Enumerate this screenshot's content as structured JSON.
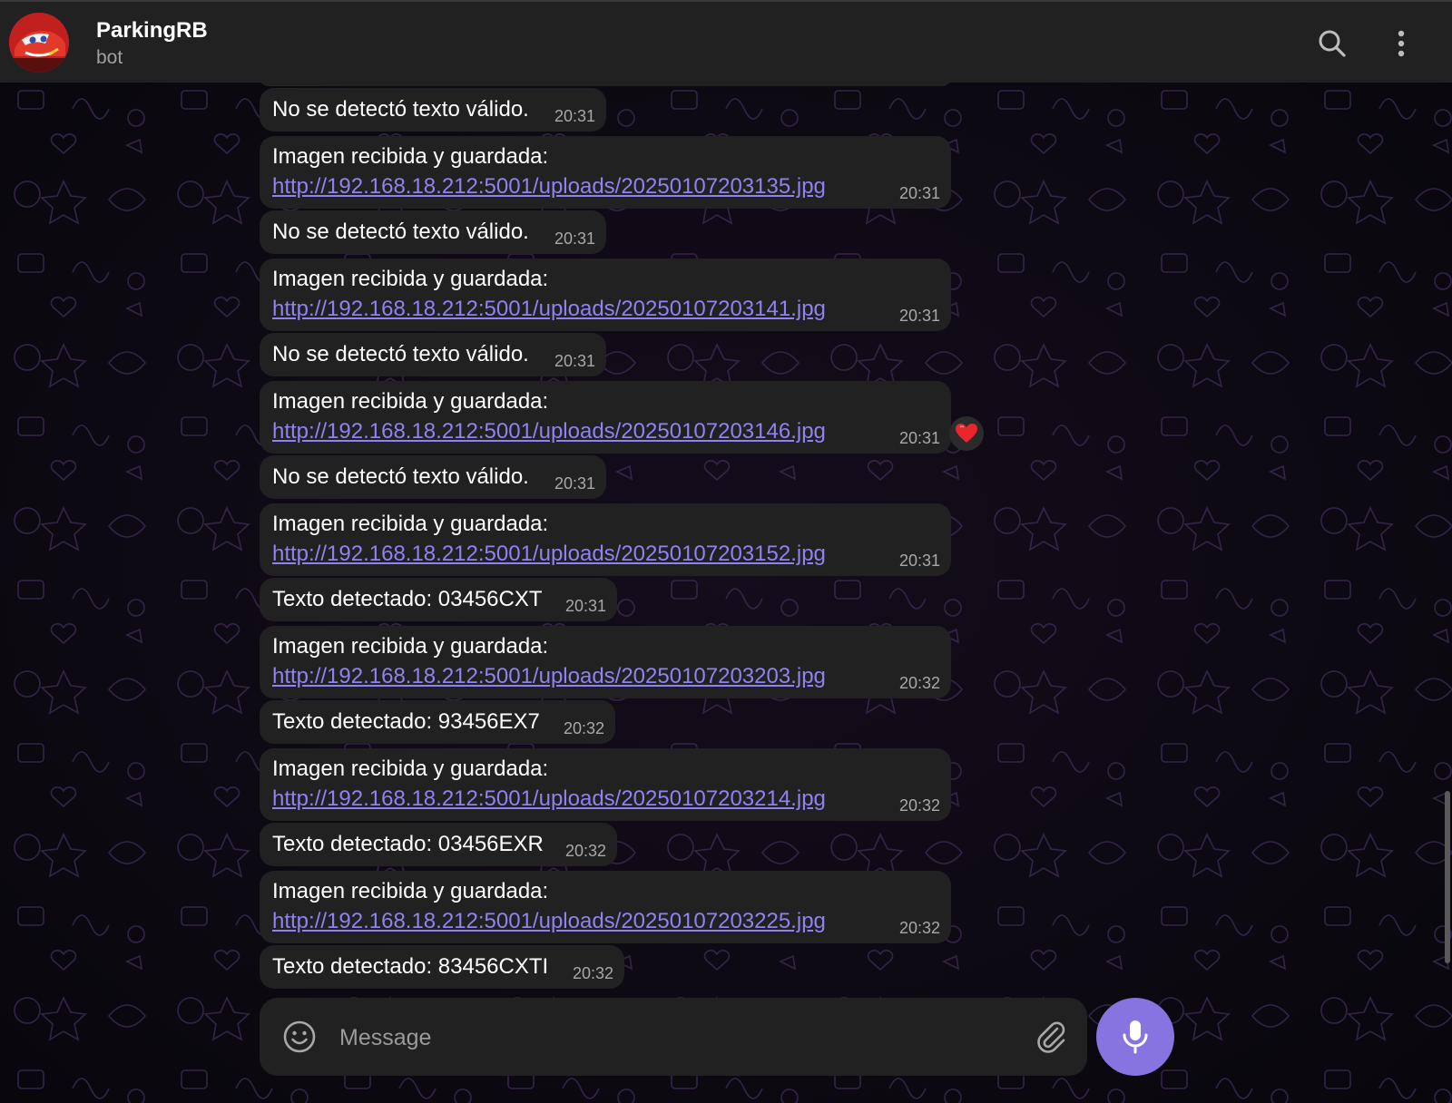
{
  "header": {
    "title": "ParkingRB",
    "subtitle": "bot",
    "search_icon": "search-icon",
    "more_icon": "more-vertical-icon"
  },
  "messages": [
    {
      "type": "text",
      "text": "No se detectó texto válido.",
      "time": "20:31"
    },
    {
      "type": "image",
      "line1": "Imagen recibida y guardada:",
      "link": "http://192.168.18.212:5001/uploads/20250107203135.jpg",
      "time": "20:31"
    },
    {
      "type": "text",
      "text": "No se detectó texto válido.",
      "time": "20:31"
    },
    {
      "type": "image",
      "line1": "Imagen recibida y guardada:",
      "link": "http://192.168.18.212:5001/uploads/20250107203141.jpg",
      "time": "20:31"
    },
    {
      "type": "text",
      "text": "No se detectó texto válido.",
      "time": "20:31"
    },
    {
      "type": "image",
      "line1": "Imagen recibida y guardada:",
      "link": "http://192.168.18.212:5001/uploads/20250107203146.jpg",
      "time": "20:31",
      "reaction": "❤️"
    },
    {
      "type": "text",
      "text": "No se detectó texto válido.",
      "time": "20:31"
    },
    {
      "type": "image",
      "line1": "Imagen recibida y guardada:",
      "link": "http://192.168.18.212:5001/uploads/20250107203152.jpg",
      "time": "20:31"
    },
    {
      "type": "text",
      "text": "Texto detectado: 03456CXT",
      "time": "20:31"
    },
    {
      "type": "image",
      "line1": "Imagen recibida y guardada:",
      "link": "http://192.168.18.212:5001/uploads/20250107203203.jpg",
      "time": "20:32"
    },
    {
      "type": "text",
      "text": "Texto detectado: 93456EX7",
      "time": "20:32"
    },
    {
      "type": "image",
      "line1": "Imagen recibida y guardada:",
      "link": "http://192.168.18.212:5001/uploads/20250107203214.jpg",
      "time": "20:32"
    },
    {
      "type": "text",
      "text": "Texto detectado: 03456EXR",
      "time": "20:32"
    },
    {
      "type": "image",
      "line1": "Imagen recibida y guardada:",
      "link": "http://192.168.18.212:5001/uploads/20250107203225.jpg",
      "time": "20:32"
    },
    {
      "type": "text",
      "text": "Texto detectado: 83456CXTI",
      "time": "20:32"
    }
  ],
  "composer": {
    "placeholder": "Message",
    "emoji_icon": "emoji-icon",
    "attach_icon": "paperclip-icon",
    "mic_icon": "microphone-icon"
  },
  "colors": {
    "accent": "#8774e1",
    "link": "#8f82f2",
    "bubble": "#212121",
    "header": "#212121"
  }
}
